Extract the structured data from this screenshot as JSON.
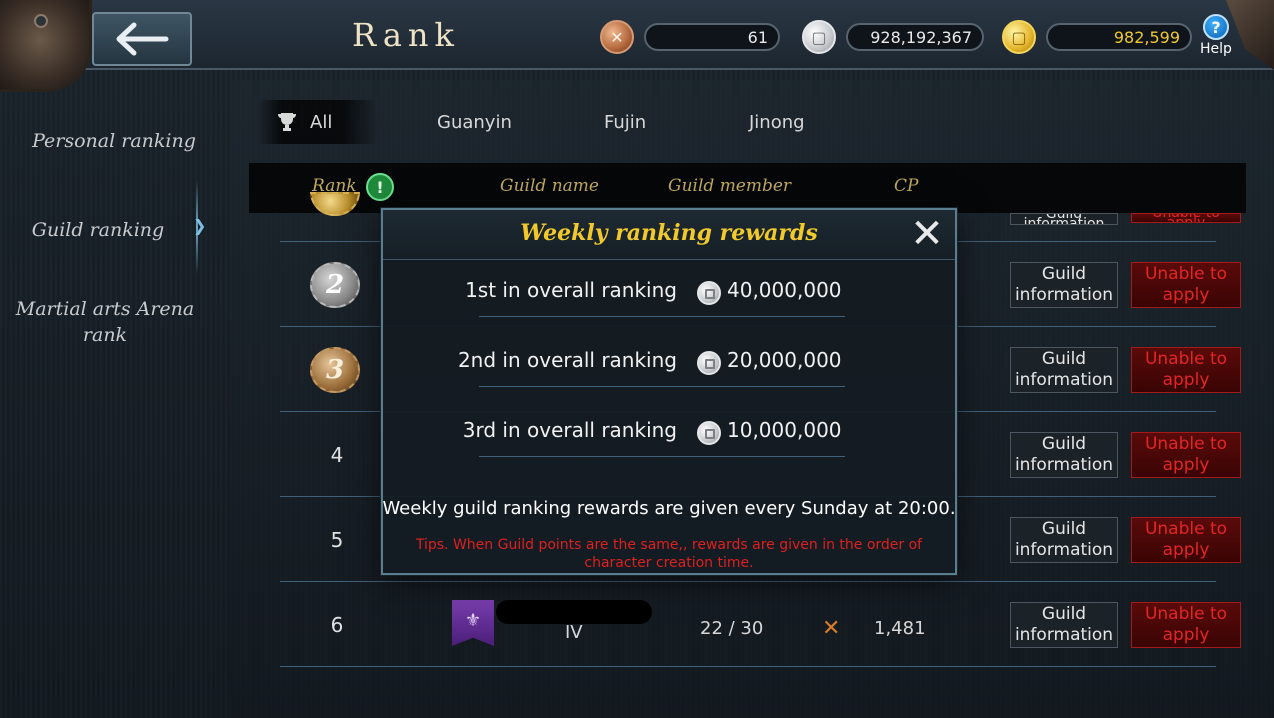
{
  "header": {
    "title": "Rank",
    "currencies": [
      {
        "icon": "copper-cross-coin-icon",
        "value": "61"
      },
      {
        "icon": "silver-coin-icon",
        "value": "928,192,367"
      },
      {
        "icon": "gold-coin-icon",
        "value": "982,599"
      }
    ],
    "help_label": "Help",
    "help_glyph": "?"
  },
  "sidebar": {
    "items": [
      {
        "label": "Personal ranking"
      },
      {
        "label": "Guild ranking",
        "selected": true
      },
      {
        "label": "Martial arts Arena rank"
      }
    ]
  },
  "tabs": [
    {
      "label": "All",
      "selected": true
    },
    {
      "label": "Guanyin"
    },
    {
      "label": "Fujin"
    },
    {
      "label": "Jinong"
    }
  ],
  "table": {
    "columns": [
      "Rank",
      "Guild name",
      "Guild member",
      "CP"
    ],
    "info_glyph": "!",
    "rows": [
      {
        "rank": "1",
        "medal": "gold",
        "info_btn": "Guild information",
        "apply_btn": "Unable to apply"
      },
      {
        "rank": "2",
        "medal": "silver",
        "info_btn": "Guild information",
        "apply_btn": "Unable to apply"
      },
      {
        "rank": "3",
        "medal": "bronze",
        "info_btn": "Guild information",
        "apply_btn": "Unable to apply"
      },
      {
        "rank": "4",
        "info_btn": "Guild information",
        "apply_btn": "Unable to apply"
      },
      {
        "rank": "5",
        "info_btn": "Guild information",
        "apply_btn": "Unable to apply"
      },
      {
        "rank": "6",
        "guild_level": "IV",
        "members": "22 / 30",
        "cp": "1,481",
        "info_btn": "Guild information",
        "apply_btn": "Unable to apply"
      }
    ]
  },
  "modal": {
    "title": "Weekly ranking rewards",
    "close_glyph": "✕",
    "rewards": [
      {
        "label": "1st in overall ranking",
        "value": "40,000,000"
      },
      {
        "label": "2nd in overall ranking",
        "value": "20,000,000"
      },
      {
        "label": "3rd in overall ranking",
        "value": "10,000,000"
      }
    ],
    "note": "Weekly guild ranking rewards are given every Sunday at 20:00.",
    "tip": "Tips. When Guild points are the same,, rewards are given in the order of character creation time."
  },
  "colors": {
    "accent_gold": "#f1c92a",
    "header_text": "#c2a95c",
    "danger_red": "#e01f1f"
  }
}
